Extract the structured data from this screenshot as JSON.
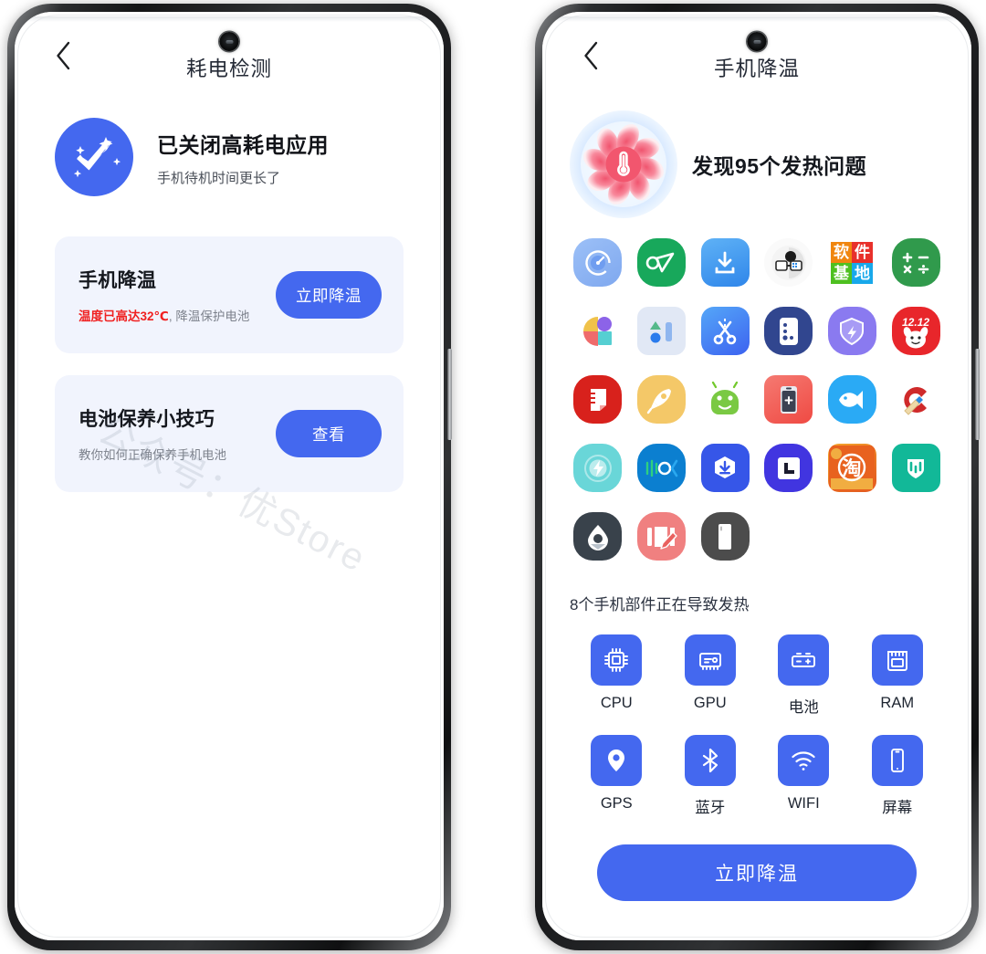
{
  "left_phone": {
    "appbar": {
      "back_icon": "chevron-left-icon",
      "title": "耗电检测"
    },
    "hero": {
      "icon": "check-sparkle-icon",
      "title": "已关闭高耗电应用",
      "subtitle": "手机待机时间更长了"
    },
    "cards": [
      {
        "title": "手机降温",
        "sub_highlight": "温度已高达32℃",
        "sub_rest": ", 降温保护电池",
        "button": "立即降温"
      },
      {
        "title": "电池保养小技巧",
        "sub_highlight": "",
        "sub_rest": "教你如何正确保养手机电池",
        "button": "查看"
      }
    ],
    "watermark": "公众号：优Store"
  },
  "right_phone": {
    "appbar": {
      "back_icon": "chevron-left-icon",
      "title": "手机降温"
    },
    "hero": {
      "icon": "fan-thermometer-icon",
      "title": "发现95个发热问题"
    },
    "app_icons": [
      {
        "name": "speed-gauge-app-icon",
        "color": "#8fb4f2"
      },
      {
        "name": "alipay-loop-app-icon",
        "color": "#18a85b"
      },
      {
        "name": "downloader-app-icon",
        "color": "#3e9af0"
      },
      {
        "name": "share-disc-app-icon",
        "color": "#f7f7f7"
      },
      {
        "name": "ruanjian-jidi-app-icon",
        "color": "#ffffff"
      },
      {
        "name": "calculator-app-icon",
        "color": "#2f9e4f"
      },
      {
        "name": "color-pie-app-icon",
        "color": "#ffffff"
      },
      {
        "name": "shapes-chart-app-icon",
        "color": "#dfe7f5"
      },
      {
        "name": "scissors-cut-app-icon",
        "color": "#3f7df5"
      },
      {
        "name": "phone-manager-app-icon",
        "color": "#31468f"
      },
      {
        "name": "shield-boost-app-icon",
        "color": "#8a7af0"
      },
      {
        "name": "jd-1212-app-icon",
        "color": "#e8262b"
      },
      {
        "name": "note-flag-app-icon",
        "color": "#d8211c"
      },
      {
        "name": "rocket-boost-app-icon",
        "color": "#f4c868"
      },
      {
        "name": "android-robot-app-icon",
        "color": "#ffffff"
      },
      {
        "name": "battery-plus-app-icon",
        "color": "#f1564f"
      },
      {
        "name": "fish-cleaner-app-icon",
        "color": "#2aaaf5"
      },
      {
        "name": "ccleaner-app-icon",
        "color": "#ffffff"
      },
      {
        "name": "flash-power-app-icon",
        "color": "#69d6d8"
      },
      {
        "name": "oppo-music-app-icon",
        "color": "#0b7fd0"
      },
      {
        "name": "store-download-app-icon",
        "color": "#3656e8"
      },
      {
        "name": "lark-doc-app-icon",
        "color": "#4135e0"
      },
      {
        "name": "taobao-app-icon",
        "color": "#f3a22a"
      },
      {
        "name": "mijia-app-icon",
        "color": "#12b898"
      },
      {
        "name": "water-drop-app-icon",
        "color": "#39424b"
      },
      {
        "name": "photo-edit-app-icon",
        "color": "#f08080"
      },
      {
        "name": "dark-phone-app-icon",
        "color": "#4c4c4c"
      }
    ],
    "parts_title": "8个手机部件正在导致发热",
    "parts": [
      {
        "label": "CPU",
        "icon": "cpu-icon"
      },
      {
        "label": "GPU",
        "icon": "gpu-icon"
      },
      {
        "label": "电池",
        "icon": "battery-icon"
      },
      {
        "label": "RAM",
        "icon": "ram-icon"
      },
      {
        "label": "GPS",
        "icon": "location-pin-icon"
      },
      {
        "label": "蓝牙",
        "icon": "bluetooth-icon"
      },
      {
        "label": "WIFI",
        "icon": "wifi-icon"
      },
      {
        "label": "屏幕",
        "icon": "screen-icon"
      }
    ],
    "cool_button": "立即降温"
  },
  "colors": {
    "accent_blue": "#4468ef",
    "card_bg": "#f1f4fd",
    "hot_red": "#f02020",
    "fan_pink": "#f2607a"
  }
}
